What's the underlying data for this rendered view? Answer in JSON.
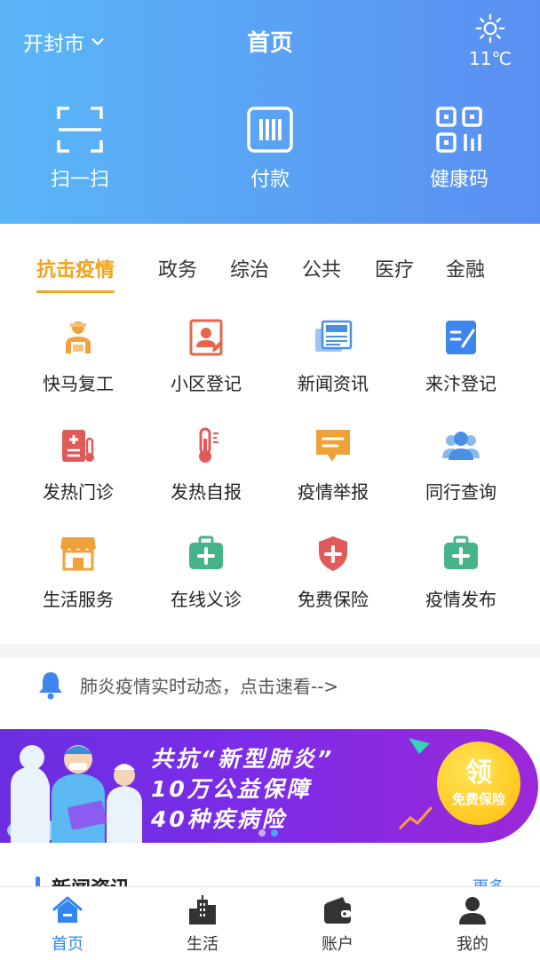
{
  "header": {
    "city": "开封市",
    "title": "首页",
    "weather": {
      "icon": "sun-icon",
      "temperature": "11℃"
    },
    "quick_actions": [
      {
        "label": "扫一扫",
        "icon": "scan-icon"
      },
      {
        "label": "付款",
        "icon": "payment-icon"
      },
      {
        "label": "健康码",
        "icon": "qr-code-icon"
      }
    ]
  },
  "categories": {
    "tabs": [
      "抗击疫情",
      "政务",
      "综治",
      "公共",
      "医疗",
      "金融"
    ],
    "active": "抗击疫情"
  },
  "services": [
    {
      "label": "快马复工",
      "icon": "worker-icon",
      "color": "#f0a23a"
    },
    {
      "label": "小区登记",
      "icon": "registration-icon",
      "color": "#e8644a"
    },
    {
      "label": "新闻资讯",
      "icon": "news-icon",
      "color": "#4a8fe6"
    },
    {
      "label": "来汴登记",
      "icon": "checklist-icon",
      "color": "#3d86ef"
    },
    {
      "label": "发热门诊",
      "icon": "clinic-icon",
      "color": "#e05a5a"
    },
    {
      "label": "发热自报",
      "icon": "thermometer-icon",
      "color": "#e05a5a"
    },
    {
      "label": "疫情举报",
      "icon": "report-icon",
      "color": "#f0a23a"
    },
    {
      "label": "同行查询",
      "icon": "group-icon",
      "color": "#4a8fe6"
    },
    {
      "label": "生活服务",
      "icon": "shop-icon",
      "color": "#f0a23a"
    },
    {
      "label": "在线义诊",
      "icon": "medkit-icon",
      "color": "#46b38a"
    },
    {
      "label": "免费保险",
      "icon": "shield-icon",
      "color": "#e05a5a"
    },
    {
      "label": "疫情发布",
      "icon": "medkit-icon",
      "color": "#46b38a"
    }
  ],
  "notice": {
    "icon": "bell-icon",
    "text": "肺炎疫情实时动态，点击速看-->"
  },
  "banner": {
    "lines": [
      "共抗“新型肺炎”",
      "10万公益保障",
      "40种疾病险"
    ],
    "badge_big": "领",
    "badge_small": "免费保险",
    "slides_total": 2,
    "slide_active": 2
  },
  "news": {
    "title": "新闻资讯",
    "more": "更多"
  },
  "bottom_nav": {
    "items": [
      {
        "label": "首页",
        "icon": "home-icon"
      },
      {
        "label": "生活",
        "icon": "buildings-icon"
      },
      {
        "label": "账户",
        "icon": "wallet-icon"
      },
      {
        "label": "我的",
        "icon": "user-icon"
      }
    ],
    "active": "首页"
  },
  "colors": {
    "brand_blue": "#3d86ef",
    "accent_orange": "#f3a21d"
  }
}
